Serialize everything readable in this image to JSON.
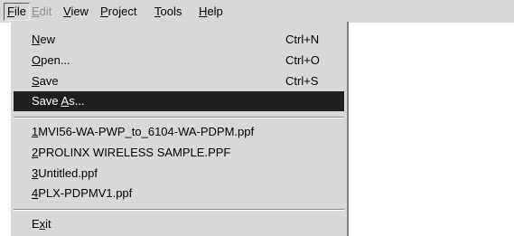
{
  "menubar": {
    "items": [
      {
        "label": "File",
        "state": "active"
      },
      {
        "label": "Edit",
        "state": "disabled"
      },
      {
        "label": "View",
        "state": "normal"
      },
      {
        "label": "Project",
        "state": "normal"
      },
      {
        "label": "Tools",
        "state": "normal"
      },
      {
        "label": "Help",
        "state": "normal"
      }
    ]
  },
  "file_menu": {
    "commands": [
      {
        "label": "New",
        "shortcut": "Ctrl+N"
      },
      {
        "label": "Open...",
        "shortcut": "Ctrl+O"
      },
      {
        "label": "Save",
        "shortcut": "Ctrl+S"
      },
      {
        "label": "Save As...",
        "state": "highlighted"
      }
    ],
    "recent_files": [
      {
        "number": "1",
        "label": "MVI56-WA-PWP_to_6104-WA-PDPM.ppf"
      },
      {
        "number": "2",
        "label": "PROLINX WIRELESS SAMPLE.PPF"
      },
      {
        "number": "3",
        "label": "Untitled.ppf"
      },
      {
        "number": "4",
        "label": "PLX-PDPMV1.ppf"
      }
    ],
    "exit_label": "Exit"
  },
  "colors": {
    "menu_background": "#d8d8d8",
    "highlight_background": "#1f1f1f",
    "highlight_text": "#ffffff",
    "disabled_text": "#8e8e8e"
  }
}
